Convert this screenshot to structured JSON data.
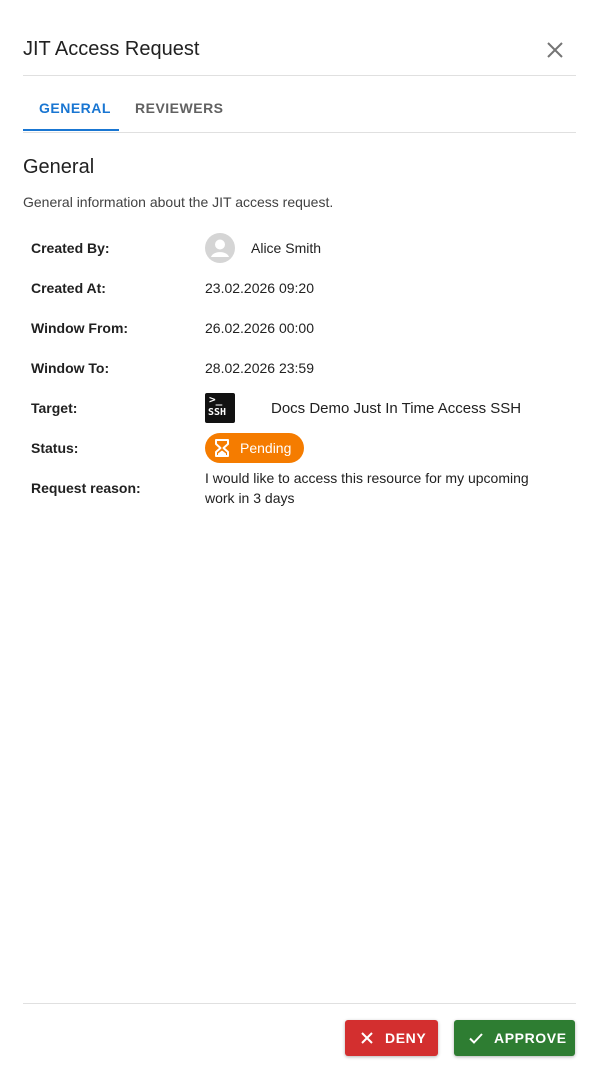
{
  "dialog": {
    "title": "JIT Access Request"
  },
  "tabs": [
    {
      "label": "GENERAL",
      "active": true
    },
    {
      "label": "REVIEWERS",
      "active": false
    }
  ],
  "general": {
    "heading": "General",
    "description": "General information about the JIT access request.",
    "fields": {
      "created_by": {
        "label": "Created By:",
        "value": "Alice Smith",
        "icon": "person-icon"
      },
      "created_at": {
        "label": "Created At:",
        "value": "23.02.2026 09:20"
      },
      "window_from": {
        "label": "Window From:",
        "value": "26.02.2026 00:00"
      },
      "window_to": {
        "label": "Window To:",
        "value": "28.02.2026 23:59"
      },
      "target": {
        "label": "Target:",
        "value": "Docs Demo Just In Time Access SSH",
        "icon": "ssh-icon",
        "icon_text": "SSH",
        "icon_prompt": ">_"
      },
      "status": {
        "label": "Status:",
        "value": "Pending",
        "icon": "hourglass-icon",
        "color": "#f57c00"
      },
      "request_reason": {
        "label": "Request reason:",
        "value_line1": "I would like to access this resource for my upcoming",
        "value_line2": "work in 3 days"
      }
    }
  },
  "footer": {
    "deny_label": "DENY",
    "approve_label": "APPROVE",
    "deny_color": "#d32f2f",
    "approve_color": "#2e7d32"
  }
}
